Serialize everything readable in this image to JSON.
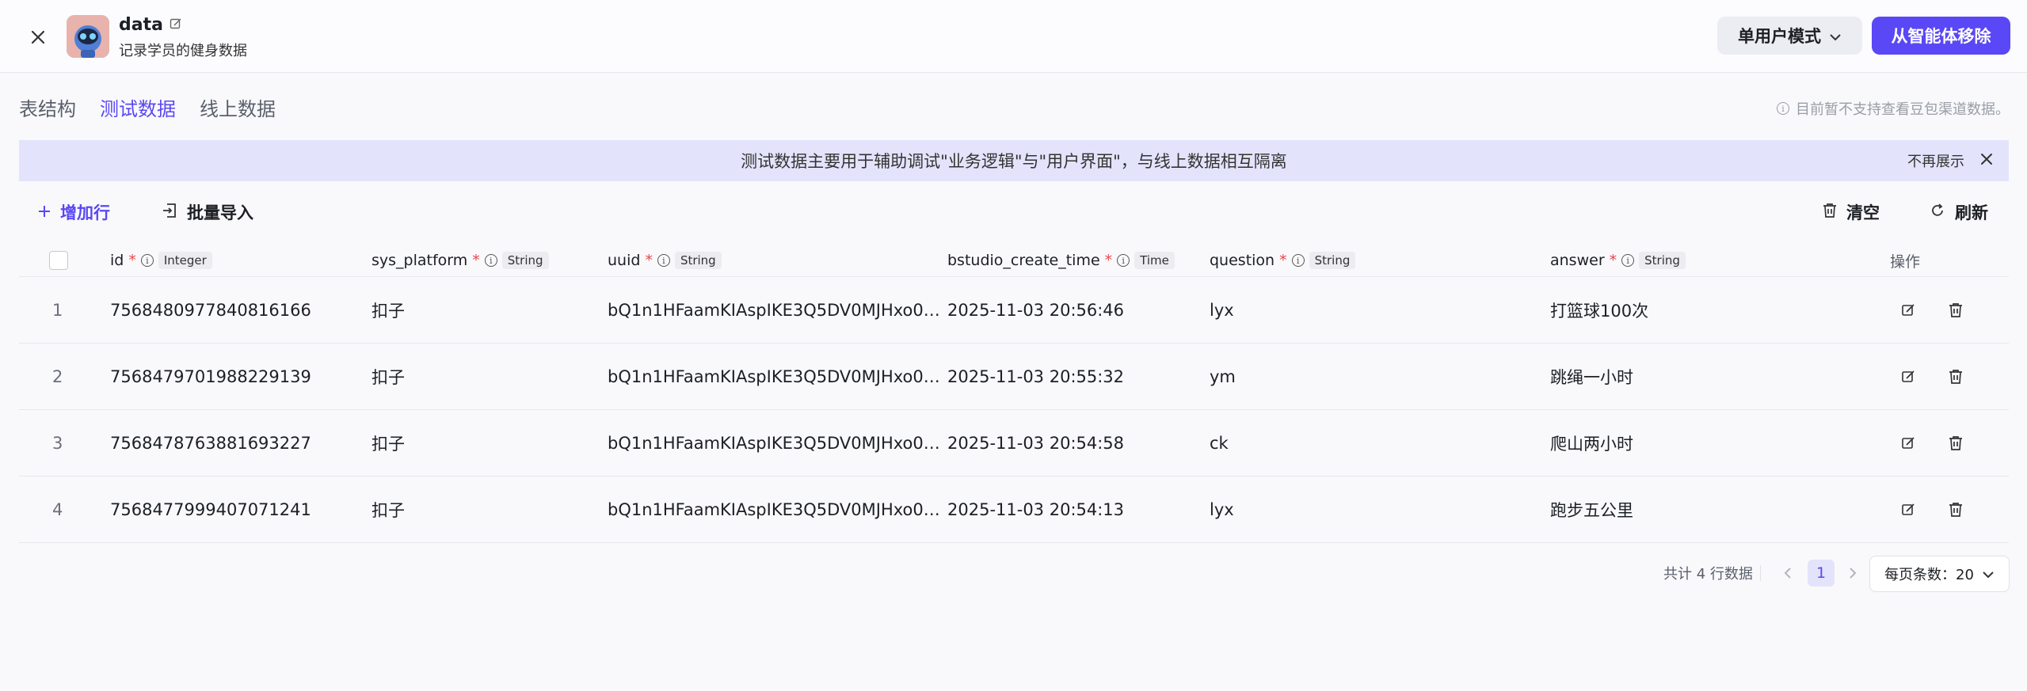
{
  "header": {
    "title": "data",
    "subtitle": "记录学员的健身数据",
    "mode_label": "单用户模式",
    "remove_label": "从智能体移除"
  },
  "tabs": [
    {
      "label": "表结构",
      "active": false
    },
    {
      "label": "测试数据",
      "active": true
    },
    {
      "label": "线上数据",
      "active": false
    }
  ],
  "notice": "目前暂不支持查看豆包渠道数据。",
  "banner": {
    "text": "测试数据主要用于辅助调试\"业务逻辑\"与\"用户界面\"，与线上数据相互隔离",
    "dismiss_label": "不再展示"
  },
  "toolbar": {
    "add_row": "增加行",
    "bulk_import": "批量导入",
    "clear": "清空",
    "refresh": "刷新"
  },
  "columns": [
    {
      "name": "id",
      "type": "Integer"
    },
    {
      "name": "sys_platform",
      "type": "String"
    },
    {
      "name": "uuid",
      "type": "String"
    },
    {
      "name": "bstudio_create_time",
      "type": "Time"
    },
    {
      "name": "question",
      "type": "String"
    },
    {
      "name": "answer",
      "type": "String"
    }
  ],
  "actions_header": "操作",
  "rows": [
    {
      "index": "1",
      "id": "7568480977840816166",
      "sys_platform": "扣子",
      "uuid": "bQ1n1HFaamKIAspIKE3Q5DV0MJHxo0…",
      "create_time": "2025-11-03 20:56:46",
      "question": "lyx",
      "answer": "打篮球100次"
    },
    {
      "index": "2",
      "id": "7568479701988229139",
      "sys_platform": "扣子",
      "uuid": "bQ1n1HFaamKIAspIKE3Q5DV0MJHxo0…",
      "create_time": "2025-11-03 20:55:32",
      "question": "ym",
      "answer": "跳绳一小时"
    },
    {
      "index": "3",
      "id": "7568478763881693227",
      "sys_platform": "扣子",
      "uuid": "bQ1n1HFaamKIAspIKE3Q5DV0MJHxo0…",
      "create_time": "2025-11-03 20:54:58",
      "question": "ck",
      "answer": "爬山两小时"
    },
    {
      "index": "4",
      "id": "7568477999407071241",
      "sys_platform": "扣子",
      "uuid": "bQ1n1HFaamKIAspIKE3Q5DV0MJHxo0…",
      "create_time": "2025-11-03 20:54:13",
      "question": "lyx",
      "answer": "跑步五公里"
    }
  ],
  "pagination": {
    "total": "共计 4 行数据",
    "current_page": "1",
    "page_size_label": "每页条数：20"
  },
  "colors": {
    "accent": "#5a47f5",
    "banner_bg": "#e3e4fb",
    "required": "#e5484d"
  }
}
